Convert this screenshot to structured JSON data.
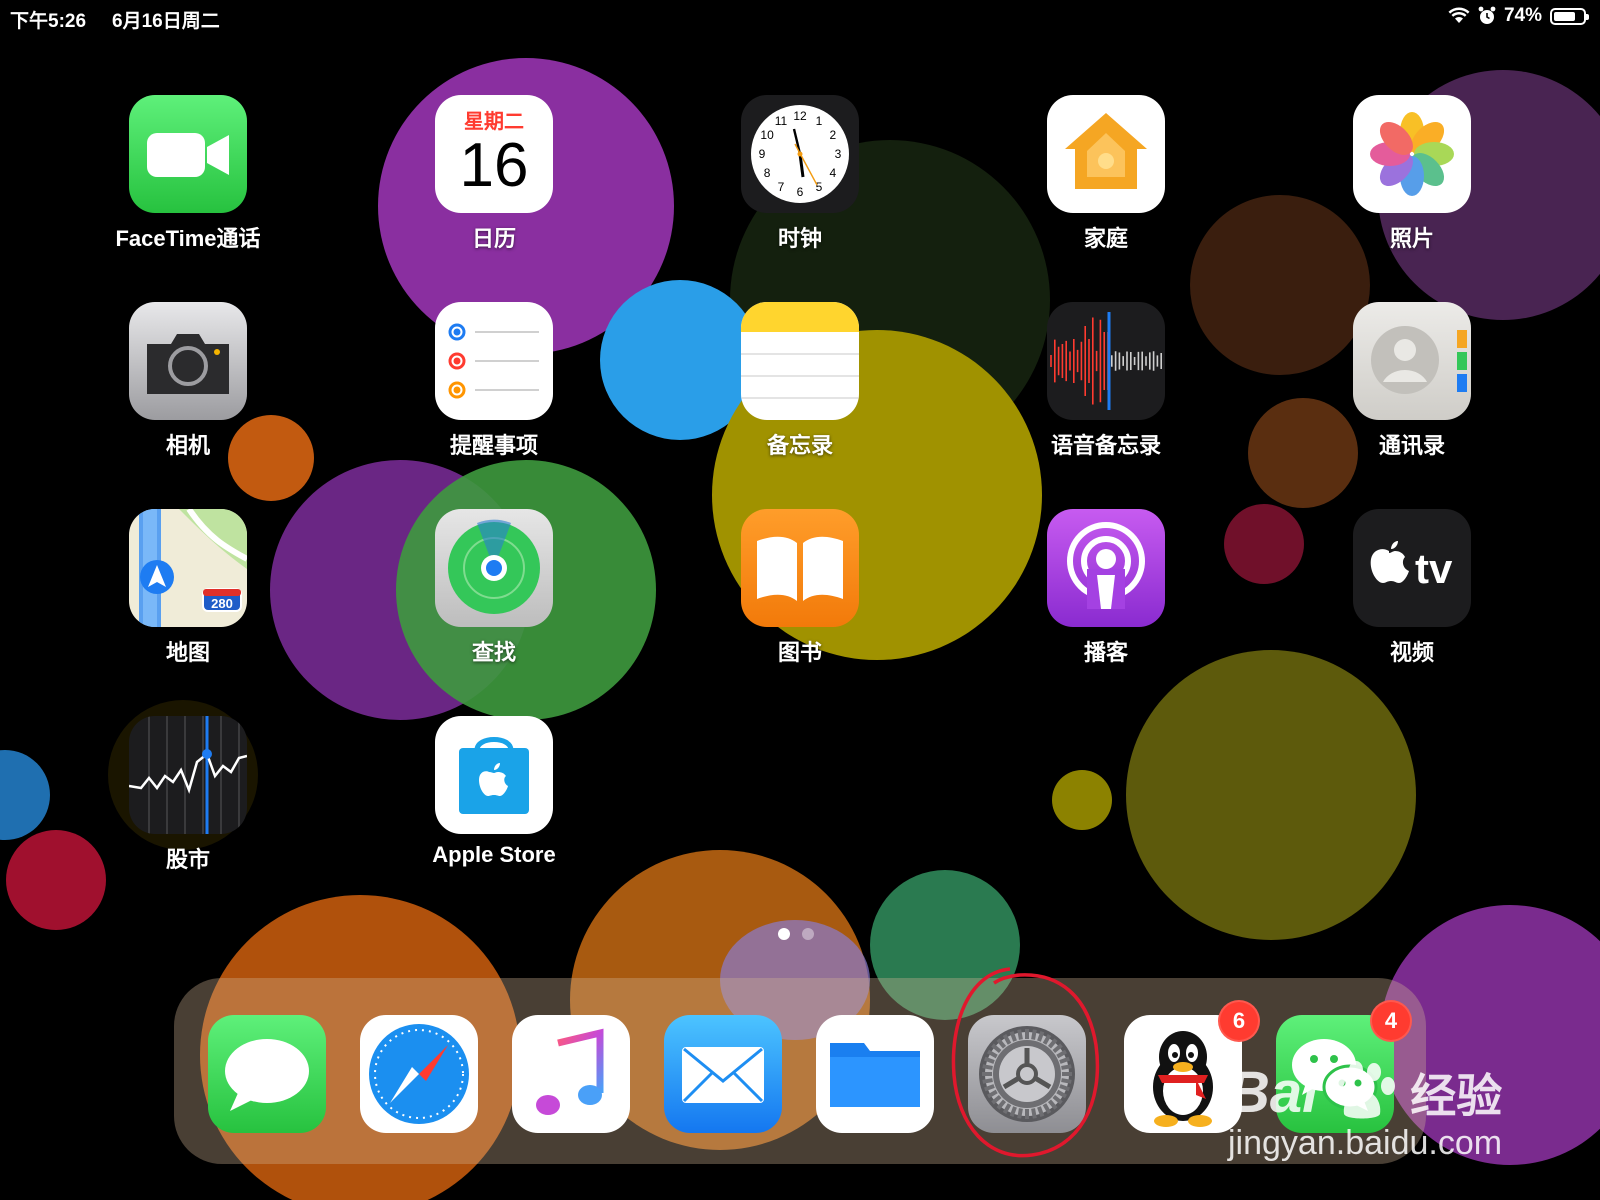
{
  "status_bar": {
    "time": "下午5:26",
    "date": "6月16日周二",
    "battery": "74%",
    "battery_level": 0.74,
    "icons": [
      "wifi-icon",
      "alarm-icon",
      "battery-icon"
    ]
  },
  "home_apps": [
    {
      "label": "FaceTime通话",
      "icon": "facetime-icon"
    },
    {
      "label": "日历",
      "icon": "calendar-icon"
    },
    {
      "label": "时钟",
      "icon": "clock-icon"
    },
    {
      "label": "家庭",
      "icon": "home-icon"
    },
    {
      "label": "照片",
      "icon": "photos-icon"
    },
    {
      "label": "相机",
      "icon": "camera-icon"
    },
    {
      "label": "提醒事项",
      "icon": "reminders-icon"
    },
    {
      "label": "备忘录",
      "icon": "notes-icon"
    },
    {
      "label": "语音备忘录",
      "icon": "voice-memos-icon"
    },
    {
      "label": "通讯录",
      "icon": "contacts-icon"
    },
    {
      "label": "地图",
      "icon": "maps-icon"
    },
    {
      "label": "查找",
      "icon": "find-my-icon"
    },
    {
      "label": "图书",
      "icon": "books-icon"
    },
    {
      "label": "播客",
      "icon": "podcasts-icon"
    },
    {
      "label": "视频",
      "icon": "apple-tv-icon"
    },
    {
      "label": "股市",
      "icon": "stocks-icon"
    },
    {
      "label": "Apple Store",
      "icon": "apple-store-icon"
    }
  ],
  "calendar_icon": {
    "weekday": "星期二",
    "day": "16"
  },
  "clock_numbers": [
    "12",
    "1",
    "2",
    "3",
    "4",
    "5",
    "6",
    "7",
    "8",
    "9",
    "10",
    "11"
  ],
  "maps_icon": {
    "shield": "280"
  },
  "tv_icon": {
    "text": "tv"
  },
  "dock": [
    {
      "icon": "messages-icon"
    },
    {
      "icon": "safari-icon"
    },
    {
      "icon": "music-icon"
    },
    {
      "icon": "mail-icon"
    },
    {
      "icon": "files-icon"
    },
    {
      "icon": "settings-icon",
      "highlighted": true
    },
    {
      "icon": "qq-icon",
      "badge": "6"
    },
    {
      "icon": "wechat-icon",
      "badge": "4"
    }
  ],
  "pages": {
    "count": 2,
    "current": 1
  },
  "watermark": {
    "brand_latin": "Bai",
    "brand_cn": "经验",
    "url": "jingyan.baidu.com"
  },
  "colors": {
    "facetime": "#34c759",
    "accent_red": "#ff3b30",
    "annotation": "#e0182d"
  }
}
